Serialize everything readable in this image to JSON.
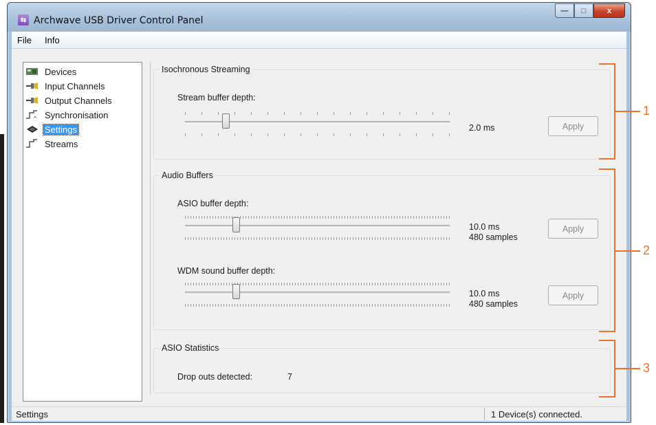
{
  "window": {
    "title": "Archwave USB Driver Control Panel"
  },
  "caption_buttons": {
    "minimize": "—",
    "maximize": "□",
    "close": "x"
  },
  "menu": [
    "File",
    "Info"
  ],
  "tree": [
    {
      "label": "Devices",
      "icon": "devices-icon",
      "selected": false
    },
    {
      "label": "Input Channels",
      "icon": "input-channels-icon",
      "selected": false
    },
    {
      "label": "Output Channels",
      "icon": "output-channels-icon",
      "selected": false
    },
    {
      "label": "Synchronisation",
      "icon": "synchronisation-icon",
      "selected": false
    },
    {
      "label": "Settings",
      "icon": "settings-icon",
      "selected": true
    },
    {
      "label": "Streams",
      "icon": "streams-icon",
      "selected": false
    }
  ],
  "isochronous": {
    "title": "Isochronous Streaming",
    "stream_label": "Stream buffer depth:",
    "stream_value": "2.0 ms",
    "stream_level": 0.08,
    "apply": "Apply"
  },
  "audio_buffers": {
    "title": "Audio Buffers",
    "asio_label": "ASIO buffer depth:",
    "asio_value": "10.0 ms",
    "asio_samples": "480 samples",
    "asio_level": 0.12,
    "asio_apply": "Apply",
    "wdm_label": "WDM sound buffer depth:",
    "wdm_value": "10.0 ms",
    "wdm_samples": "480 samples",
    "wdm_level": 0.12,
    "wdm_apply": "Apply"
  },
  "asio_stats": {
    "title": "ASIO Statistics",
    "dropouts_label": "Drop outs detected:",
    "dropouts_value": "7"
  },
  "status": {
    "left": "Settings",
    "right": "1 Device(s) connected."
  },
  "callouts": [
    "1",
    "2",
    "3"
  ],
  "colors": {
    "callout": "#e8732e",
    "selection": "#3399ff"
  }
}
